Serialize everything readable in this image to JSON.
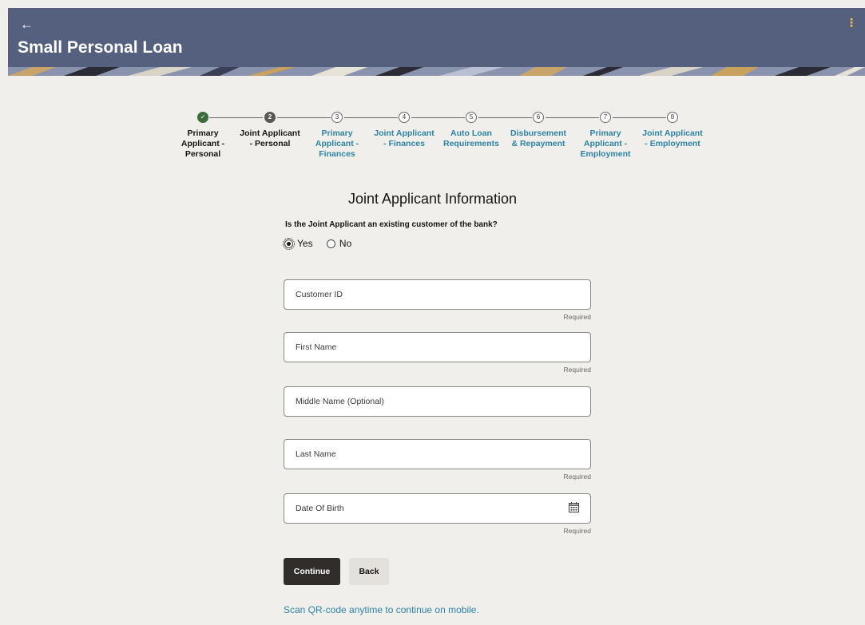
{
  "header": {
    "back_icon": "←",
    "title": "Small Personal Loan",
    "menu_icon": "⋮",
    "bg_color": "#54607e"
  },
  "stepper": {
    "steps": [
      {
        "number": "",
        "state": "done",
        "label_lines": [
          "Primary",
          "Applicant -",
          "Personal"
        ]
      },
      {
        "number": "2",
        "state": "current",
        "label_lines": [
          "Joint Applicant",
          "- Personal"
        ]
      },
      {
        "number": "3",
        "state": "upcoming",
        "label_lines": [
          "Primary",
          "Applicant -",
          "Finances"
        ]
      },
      {
        "number": "4",
        "state": "upcoming",
        "label_lines": [
          "Joint Applicant",
          "- Finances"
        ]
      },
      {
        "number": "5",
        "state": "upcoming",
        "label_lines": [
          "Auto Loan",
          "Requirements"
        ]
      },
      {
        "number": "6",
        "state": "upcoming",
        "label_lines": [
          "Disbursement",
          "& Repayment"
        ]
      },
      {
        "number": "7",
        "state": "upcoming",
        "label_lines": [
          "Primary",
          "Applicant -",
          "Employment"
        ]
      },
      {
        "number": "8",
        "state": "upcoming",
        "label_lines": [
          "Joint Applicant",
          "- Employment"
        ]
      }
    ],
    "check_icon": "✓"
  },
  "form": {
    "heading": "Joint Applicant Information",
    "question": "Is the Joint Applicant an existing customer of the bank?",
    "options": {
      "yes": "Yes",
      "no": "No",
      "selected": "Yes"
    },
    "fields": {
      "customer_id": {
        "placeholder": "Customer ID",
        "hint": "Required"
      },
      "first_name": {
        "placeholder": "First Name",
        "hint": "Required"
      },
      "middle_name": {
        "placeholder": "Middle Name (Optional)",
        "hint": ""
      },
      "last_name": {
        "placeholder": "Last Name",
        "hint": "Required"
      },
      "date_of_birth": {
        "placeholder": "Date Of Birth",
        "hint": "Required",
        "icon": "calendar-icon"
      }
    },
    "continue_label": "Continue",
    "back_label": "Back",
    "qr_text": "Scan QR-code anytime to continue on mobile."
  },
  "colors": {
    "link": "#2d83a6",
    "primary_button": "#312d2a",
    "step_done": "#3a6d3a"
  }
}
